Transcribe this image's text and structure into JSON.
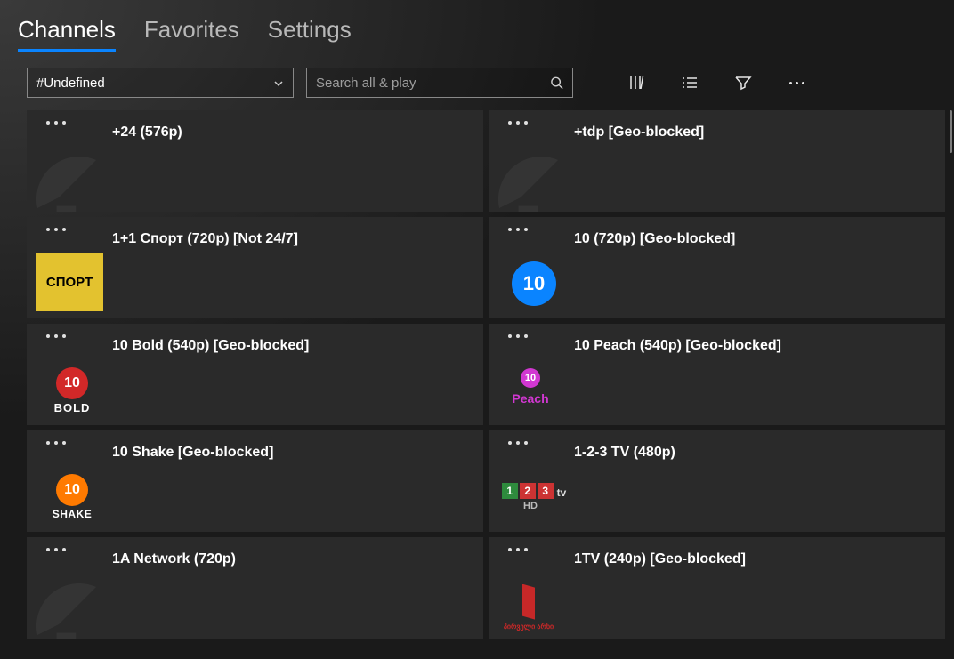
{
  "tabs": {
    "channels": "Channels",
    "favorites": "Favorites",
    "settings": "Settings"
  },
  "toolbar": {
    "dropdown_value": "#Undefined",
    "search_placeholder": "Search all & play"
  },
  "channels": [
    {
      "title": "+24 (576p)",
      "logo": "dish"
    },
    {
      "title": "+tdp [Geo-blocked]",
      "logo": "dish"
    },
    {
      "title": "1+1 Спорт (720p) [Not 24/7]",
      "logo": "sport",
      "logo_text": "СПОРТ"
    },
    {
      "title": "10 (720p) [Geo-blocked]",
      "logo": "ten",
      "logo_text": "10"
    },
    {
      "title": "10 Bold (540p) [Geo-blocked]",
      "logo": "tenbold",
      "logo_text": "10",
      "logo_sub": "BOLD"
    },
    {
      "title": "10 Peach (540p) [Geo-blocked]",
      "logo": "tenpeach",
      "logo_text": "10",
      "logo_sub": "Peach"
    },
    {
      "title": "10 Shake [Geo-blocked]",
      "logo": "tenshake",
      "logo_text": "10",
      "logo_sub": "SHAKE"
    },
    {
      "title": "1-2-3 TV (480p)",
      "logo": "onetwothree",
      "logo_sub": "HD"
    },
    {
      "title": "1A Network (720p)",
      "logo": "dish"
    },
    {
      "title": "1TV (240p) [Geo-blocked]",
      "logo": "onetv",
      "logo_sub": "პირველი\nარხი"
    }
  ]
}
